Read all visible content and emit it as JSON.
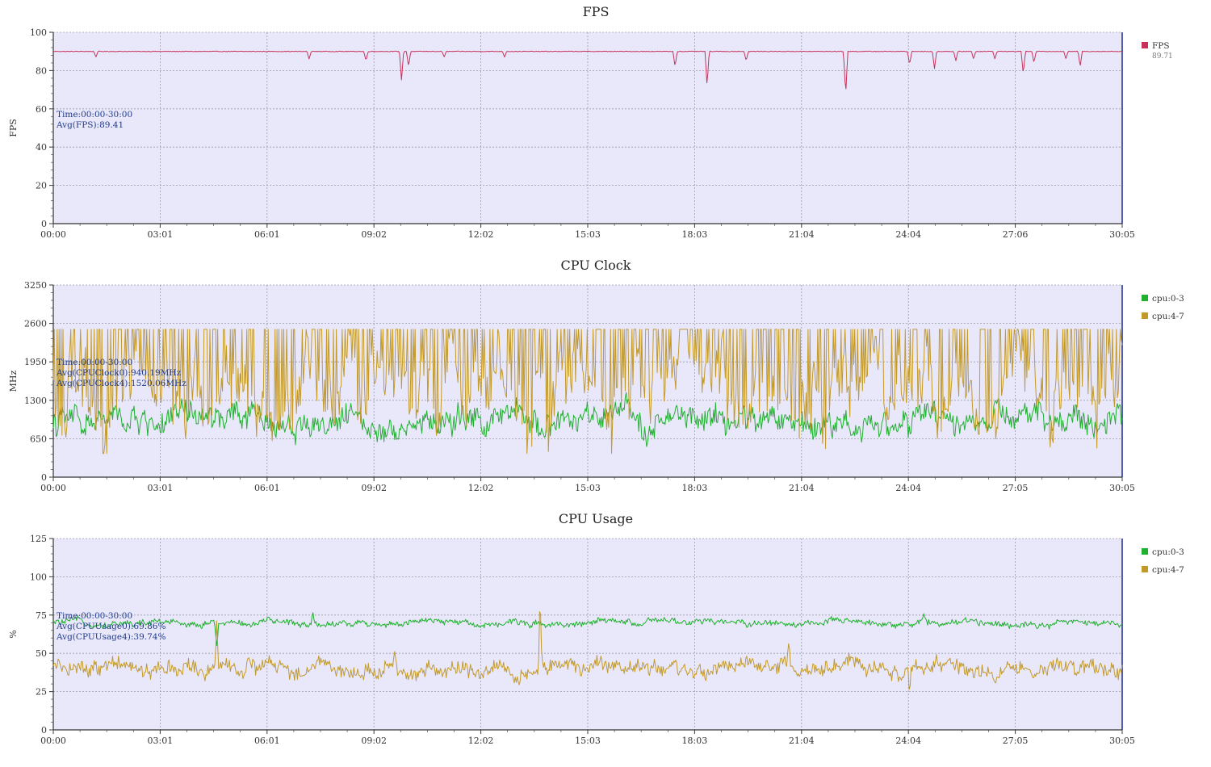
{
  "chart_data": [
    {
      "id": "fps",
      "type": "line",
      "title": "FPS",
      "ylabel": "FPS",
      "ylim": [
        0,
        100
      ],
      "yticks": [
        "0",
        "20",
        "40",
        "60",
        "80",
        "100"
      ],
      "xlim": [
        0,
        30.083
      ],
      "xticks": [
        "00:00",
        "03:01",
        "06:01",
        "09:02",
        "12:02",
        "15:03",
        "18:03",
        "21:04",
        "24:04",
        "27:06",
        "30:05"
      ],
      "grid": true,
      "annotations": [
        "Time:00:00-30:00",
        "Avg(FPS):89.41"
      ],
      "legend": {
        "position": "right",
        "entries": [
          {
            "label": "FPS",
            "sub": "89.71"
          }
        ]
      },
      "series": [
        {
          "name": "FPS",
          "color": "#c8325a",
          "base": 90,
          "noise": 0.3,
          "clip": [
            0,
            100
          ],
          "dips": [
            [
              1.2,
              87
            ],
            [
              7.2,
              86
            ],
            [
              8.8,
              85
            ],
            [
              9.8,
              75
            ],
            [
              10.0,
              82
            ],
            [
              11.0,
              87
            ],
            [
              12.7,
              87
            ],
            [
              17.5,
              82
            ],
            [
              18.4,
              72
            ],
            [
              19.5,
              85
            ],
            [
              22.3,
              67
            ],
            [
              24.1,
              83
            ],
            [
              24.8,
              81
            ],
            [
              25.4,
              85
            ],
            [
              25.9,
              86
            ],
            [
              26.5,
              86
            ],
            [
              27.3,
              78
            ],
            [
              27.6,
              84
            ],
            [
              28.5,
              86
            ],
            [
              28.9,
              82
            ]
          ]
        }
      ]
    },
    {
      "id": "cpu-clock",
      "type": "line",
      "title": "CPU Clock",
      "ylabel": "MHz",
      "ylim": [
        0,
        3250
      ],
      "yticks": [
        "0",
        "650",
        "1300",
        "1950",
        "2600",
        "3250"
      ],
      "xlim": [
        0,
        30.083
      ],
      "xticks": [
        "00:00",
        "03:01",
        "06:01",
        "09:02",
        "12:02",
        "15:03",
        "18:03",
        "21:04",
        "24:04",
        "27:05",
        "30:05"
      ],
      "grid": true,
      "annotations": [
        "Time:00:00-30:00",
        "Avg(CPUClock0):940.19MHz",
        "Avg(CPUClock4):1520.06MHz"
      ],
      "legend": {
        "position": "right",
        "entries": [
          {
            "label": "cpu:0-3"
          },
          {
            "label": "cpu:4-7"
          }
        ]
      },
      "series": [
        {
          "name": "cpu:0-3",
          "color": "#22b030",
          "base": 940,
          "noise": 230,
          "clip": [
            500,
            2000
          ]
        },
        {
          "name": "cpu:4-7",
          "color": "#c39a2a",
          "base": 1520,
          "noise": 580,
          "clip": [
            400,
            2500
          ]
        }
      ]
    },
    {
      "id": "cpu-usage",
      "type": "line",
      "title": "CPU Usage",
      "ylabel": "%",
      "ylim": [
        0,
        125
      ],
      "yticks": [
        "0",
        "25",
        "50",
        "75",
        "100",
        "125"
      ],
      "xlim": [
        0,
        30.083
      ],
      "xticks": [
        "00:00",
        "03:01",
        "06:01",
        "09:02",
        "12:02",
        "15:03",
        "18:03",
        "21:04",
        "24:04",
        "27:05",
        "30:05"
      ],
      "grid": true,
      "annotations": [
        "Time:00:00-30:00",
        "Avg(CPUUsage0):69.86%",
        "Avg(CPUUsage4):39.74%"
      ],
      "legend": {
        "position": "right",
        "entries": [
          {
            "label": "cpu:0-3"
          },
          {
            "label": "cpu:4-7"
          }
        ]
      },
      "series": [
        {
          "name": "cpu:0-3",
          "color": "#22b030",
          "base": 69.9,
          "noise": 2.2,
          "clip": [
            55,
            80
          ],
          "spikes": [
            [
              4.6,
              50
            ],
            [
              7.3,
              78
            ],
            [
              24.5,
              76
            ]
          ]
        },
        {
          "name": "cpu:4-7",
          "color": "#c39a2a",
          "base": 39.7,
          "noise": 5.5,
          "clip": [
            18,
            95
          ],
          "spikes": [
            [
              4.6,
              72
            ],
            [
              13.7,
              90
            ],
            [
              9.6,
              52
            ],
            [
              20.7,
              58
            ],
            [
              24.1,
              22
            ]
          ]
        }
      ]
    }
  ]
}
